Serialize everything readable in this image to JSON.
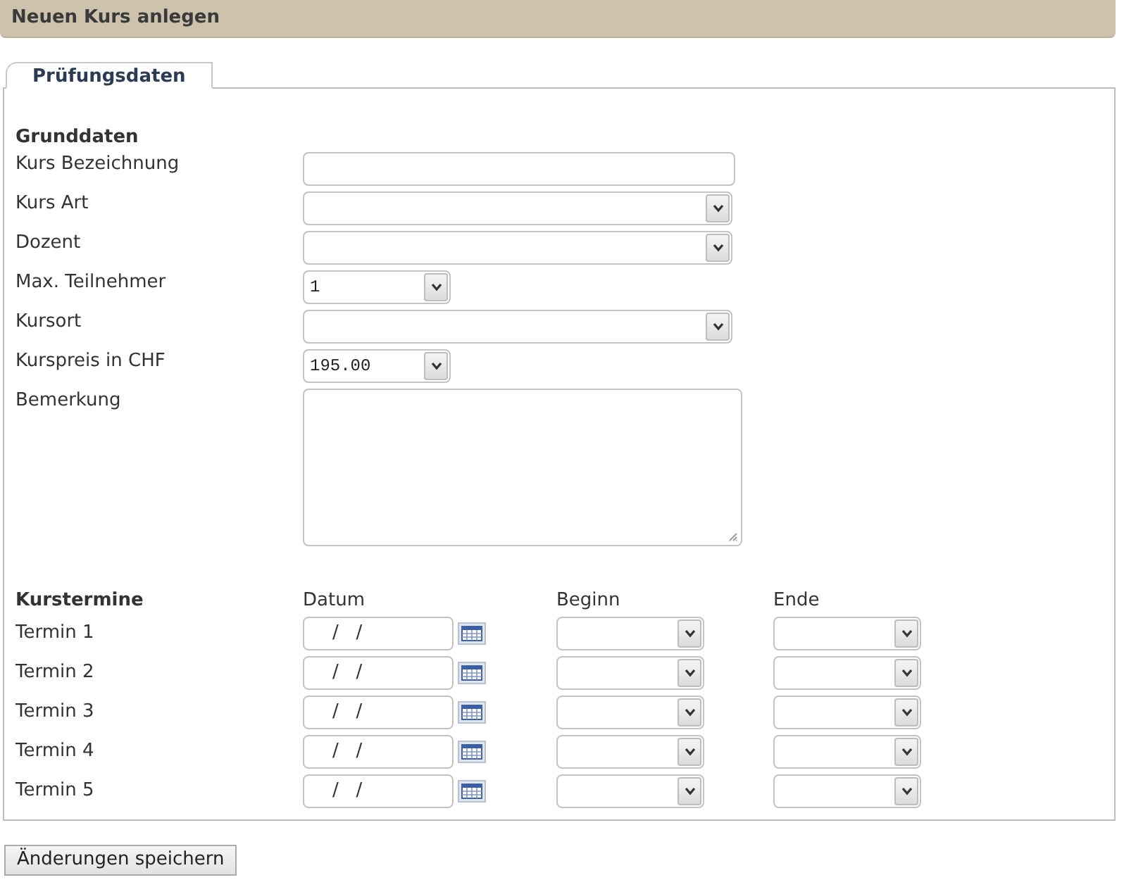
{
  "header": {
    "title": "Neuen Kurs anlegen"
  },
  "tabs": [
    {
      "label": "Prüfungsdaten",
      "selected": true
    }
  ],
  "grunddaten": {
    "title": "Grunddaten",
    "fields": [
      {
        "label": "Kurs Bezeichnung",
        "kind": "text"
      },
      {
        "label": "Kurs Art",
        "kind": "select"
      },
      {
        "label": "Dozent",
        "kind": "select"
      },
      {
        "label": "Max. Teilnehmer",
        "kind": "shortselect",
        "value": "1"
      },
      {
        "label": "Kursort",
        "kind": "select"
      },
      {
        "label": "Kurspreis in CHF",
        "kind": "shortselect",
        "value": "195.00"
      },
      {
        "label": "Bemerkung",
        "kind": "textarea"
      }
    ]
  },
  "kurstermine": {
    "title": "Kurstermine",
    "columns": [
      "Datum",
      "Beginn",
      "Ende"
    ],
    "rows": [
      {
        "label": "Termin 1",
        "date": "/   /"
      },
      {
        "label": "Termin 2",
        "date": "/   /"
      },
      {
        "label": "Termin 3",
        "date": "/   /"
      },
      {
        "label": "Termin 4",
        "date": "/   /"
      },
      {
        "label": "Termin 5",
        "date": "/   /"
      }
    ]
  },
  "save_button": "Änderungen speichern"
}
